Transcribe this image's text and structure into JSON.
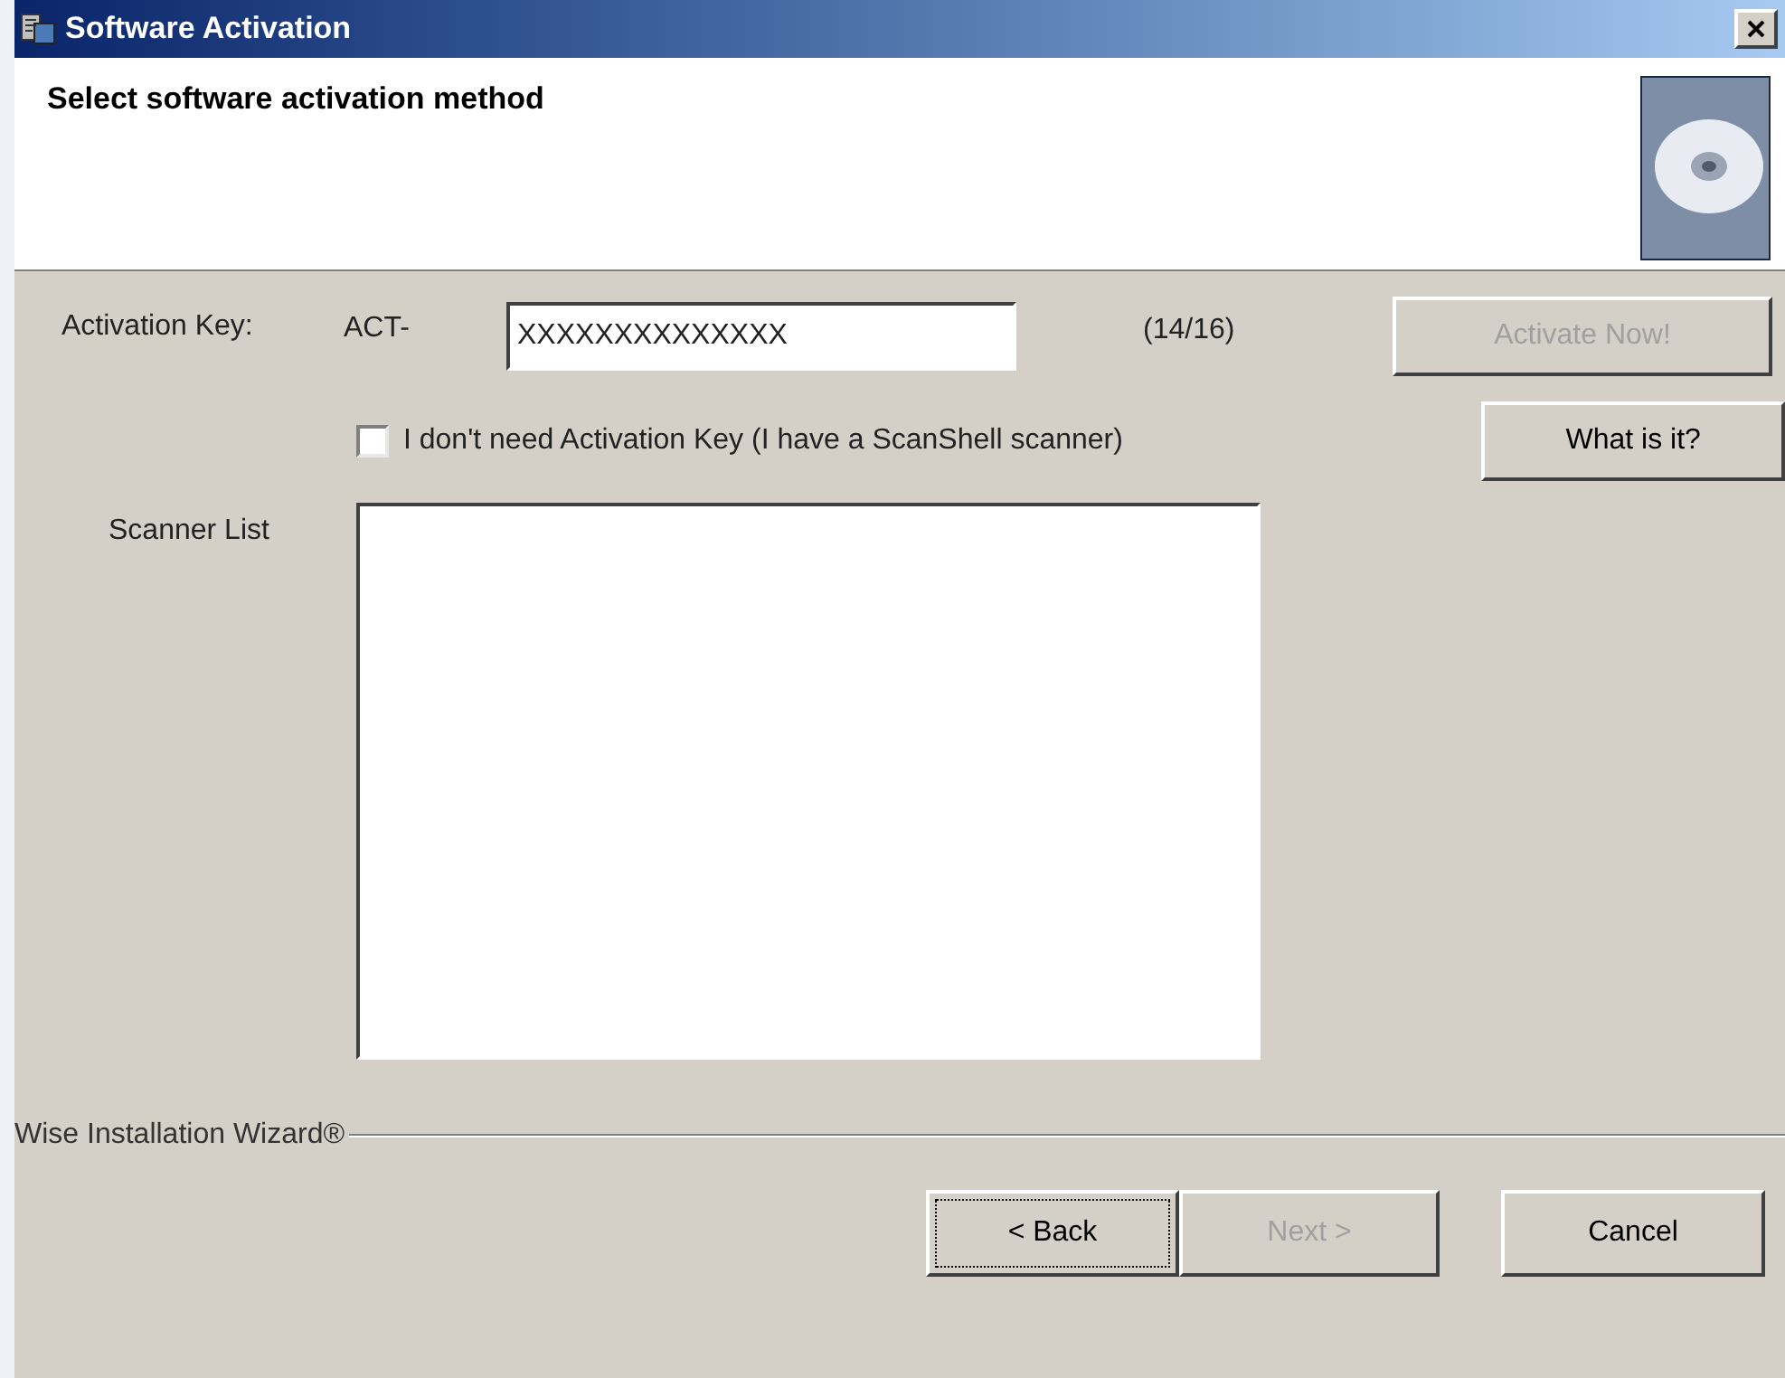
{
  "window": {
    "title": "Software Activation"
  },
  "header": {
    "title": "Select software activation method"
  },
  "activation": {
    "label": "Activation Key:",
    "prefix": "ACT-",
    "value": "XXXXXXXXXXXXXX",
    "count": "(14/16)",
    "activate_button": {
      "label": "Activate Now!",
      "disabled": true
    }
  },
  "no_key_checkbox": {
    "label": "I don't need Activation Key (I have a ScanShell scanner)",
    "checked": false
  },
  "what_button": {
    "label": "What is it?"
  },
  "scanner_list": {
    "label": "Scanner List"
  },
  "footer": {
    "brand": "Wise Installation Wizard®",
    "buttons": [
      {
        "label": "< Back",
        "disabled": false,
        "focused": true
      },
      {
        "label": "Next >",
        "disabled": true,
        "focused": false
      },
      {
        "label": "Cancel",
        "disabled": false,
        "focused": false
      }
    ]
  }
}
